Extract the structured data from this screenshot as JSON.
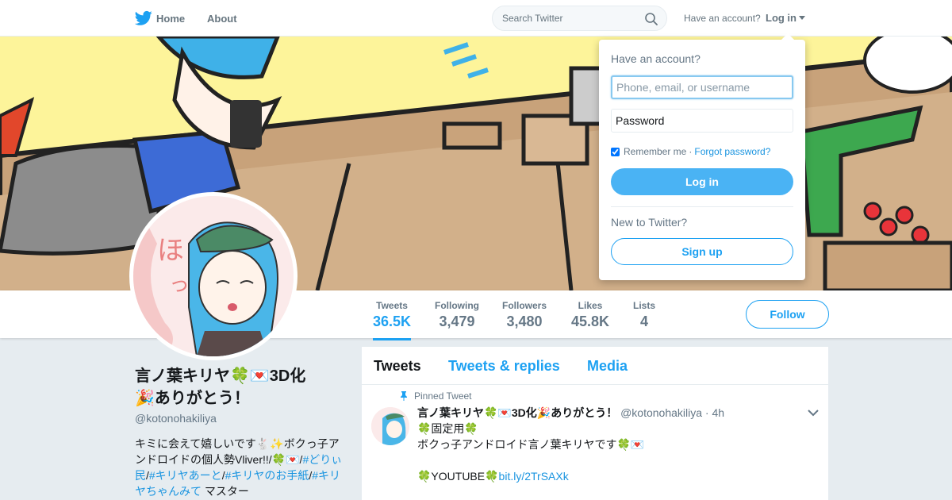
{
  "topbar": {
    "home_label": "Home",
    "about_label": "About",
    "search_placeholder": "Search Twitter",
    "have_account_label": "Have an account?",
    "login_label": "Log in"
  },
  "profile": {
    "name": "言ノ葉キリヤ🍀💌3D化🎉ありがとう！",
    "handle": "@kotonohakiliya",
    "bio_segments": [
      {
        "text": "キミに会えて嬉しいです🐇✨ボクっ子アンドロイドの個人勢Vliver!!/🍀💌/",
        "link": false
      },
      {
        "text": "#どりぃ民",
        "link": true
      },
      {
        "text": "/",
        "link": false
      },
      {
        "text": "#キリヤあーと",
        "link": true
      },
      {
        "text": "/",
        "link": false
      },
      {
        "text": "#キリヤのお手紙",
        "link": true
      },
      {
        "text": "/",
        "link": false
      },
      {
        "text": "#キリヤちゃんみて",
        "link": true
      },
      {
        "text": " マスター",
        "link": false
      }
    ]
  },
  "stats": [
    {
      "label": "Tweets",
      "value": "36.5K",
      "active": true
    },
    {
      "label": "Following",
      "value": "3,479",
      "active": false
    },
    {
      "label": "Followers",
      "value": "3,480",
      "active": false
    },
    {
      "label": "Likes",
      "value": "45.8K",
      "active": false
    },
    {
      "label": "Lists",
      "value": "4",
      "active": false
    }
  ],
  "follow_label": "Follow",
  "timeline": {
    "tabs": [
      "Tweets",
      "Tweets & replies",
      "Media"
    ],
    "pinned_label": "Pinned Tweet",
    "tweet": {
      "name": "言ノ葉キリヤ🍀💌3D化🎉ありがとう！",
      "handle": "@kotonohakiliya",
      "separator": "·",
      "time": "4h",
      "lines": [
        "🍀固定用🍀",
        "ボクっ子アンドロイド言ノ葉キリヤです🍀💌",
        "",
        "🍀YOUTUBE🍀"
      ],
      "link": "bit.ly/2TrSAXk"
    }
  },
  "login_dropdown": {
    "title": "Have an account?",
    "username_placeholder": "Phone, email, or username",
    "password_placeholder": "Password",
    "remember_label": "Remember me",
    "separator": "·",
    "forgot_label": "Forgot password?",
    "login_button": "Log in",
    "new_label": "New to Twitter?",
    "signup_button": "Sign up"
  },
  "colors": {
    "accent": "#1da1f2",
    "login_button": "#4ab3f4",
    "background": "#e6ecf0",
    "banner_yellow": "#fdf49a"
  }
}
